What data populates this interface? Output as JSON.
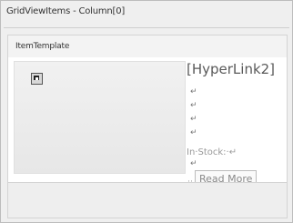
{
  "window": {
    "title": "GridViewItems - Column[0]"
  },
  "template": {
    "label": "ItemTemplate"
  },
  "content": {
    "image_icon": "image-placeholder-icon",
    "hyperlink_text": "[HyperLink2]",
    "line_break_marker": "↵",
    "in_stock_text": "In·Stock:·↵",
    "read_more_prefix": "::",
    "read_more_text": "Read More"
  }
}
